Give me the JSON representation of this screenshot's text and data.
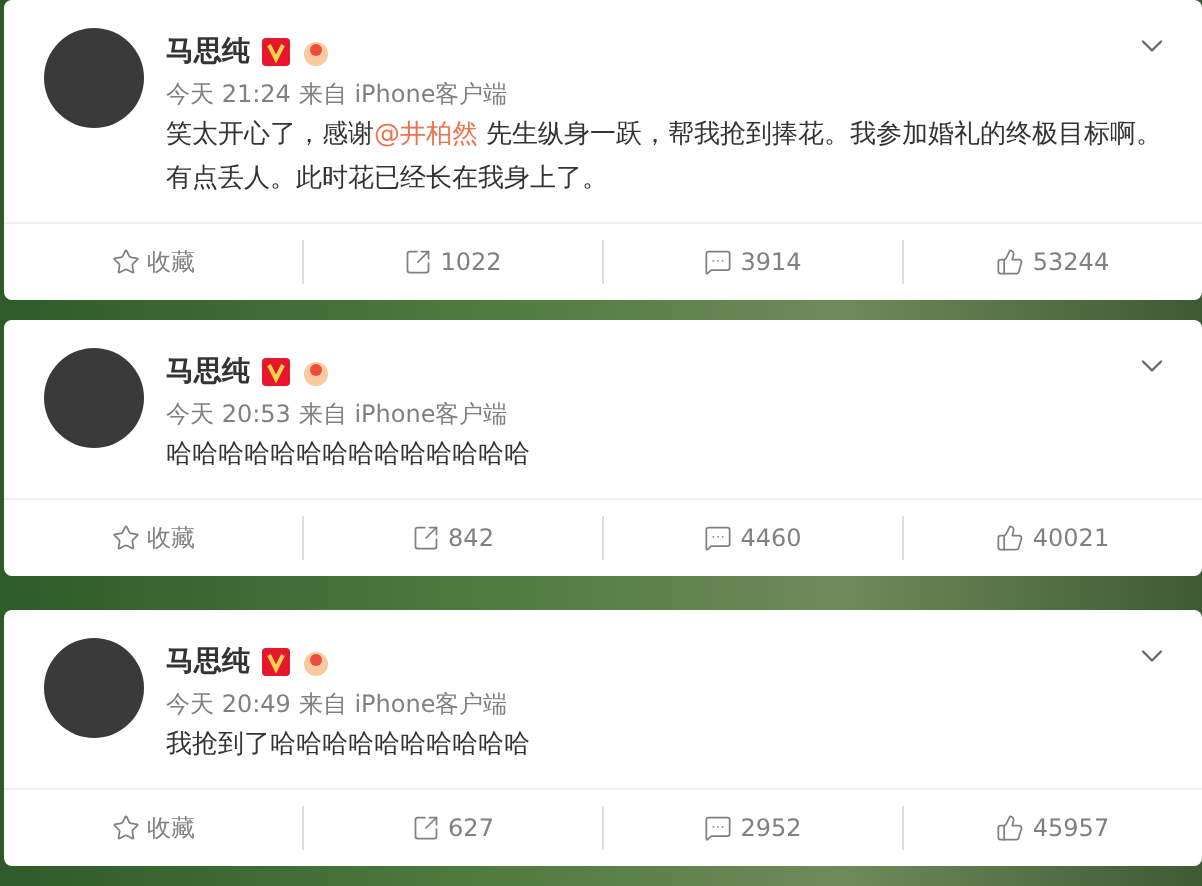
{
  "posts": [
    {
      "author": "马思纯",
      "time": "今天 21:24",
      "source": "来自 iPhone客户端",
      "body": [
        {
          "kind": "text",
          "text": "笑太开心了，感谢"
        },
        {
          "kind": "mention",
          "text": "@井柏然"
        },
        {
          "kind": "text",
          "text": " 先生纵身一跃，帮我抢到捧花。我参加婚礼的终极目标啊。有点丢人。此时花已经长在我身上了。"
        }
      ],
      "actions": {
        "favorite": "收藏",
        "reposts": "1022",
        "comments": "3914",
        "likes": "53244"
      }
    },
    {
      "author": "马思纯",
      "time": "今天 20:53",
      "source": "来自 iPhone客户端",
      "body": [
        {
          "kind": "text",
          "text": "哈哈哈哈哈哈哈哈哈哈哈哈哈哈"
        }
      ],
      "actions": {
        "favorite": "收藏",
        "reposts": "842",
        "comments": "4460",
        "likes": "40021"
      }
    },
    {
      "author": "马思纯",
      "time": "今天 20:49",
      "source": "来自 iPhone客户端",
      "body": [
        {
          "kind": "text",
          "text": "我抢到了哈哈哈哈哈哈哈哈哈哈"
        }
      ],
      "actions": {
        "favorite": "收藏",
        "reposts": "627",
        "comments": "2952",
        "likes": "45957"
      }
    }
  ]
}
